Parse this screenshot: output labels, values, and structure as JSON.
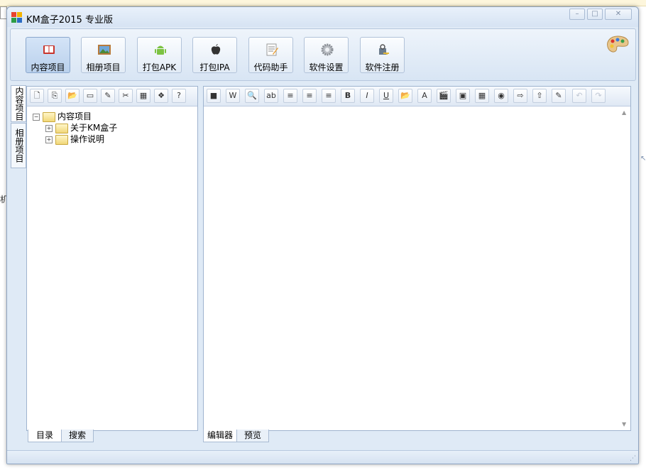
{
  "window": {
    "title": "KM盒子2015 专业版",
    "controls": [
      "minimize",
      "maximize",
      "close"
    ]
  },
  "ribbon": {
    "buttons": [
      {
        "label": "内容项目",
        "icon": "book-icon",
        "active": true
      },
      {
        "label": "相册项目",
        "icon": "picture-icon",
        "active": false
      },
      {
        "label": "打包APK",
        "icon": "android-icon",
        "active": false
      },
      {
        "label": "打包IPA",
        "icon": "apple-icon",
        "active": false
      },
      {
        "label": "代码助手",
        "icon": "notepad-icon",
        "active": false
      },
      {
        "label": "软件设置",
        "icon": "gear-icon",
        "active": false
      },
      {
        "label": "软件注册",
        "icon": "key-icon",
        "active": false
      }
    ],
    "skin_icon": "palette-icon"
  },
  "side_tabs": [
    {
      "label": "内容项目",
      "selected": true
    },
    {
      "label": "相册项目",
      "selected": false
    }
  ],
  "left_toolbar": {
    "icons": [
      "new-file-icon",
      "copy-file-icon",
      "open-folder-icon",
      "export-icon",
      "edit-icon",
      "tools-icon",
      "qrcode-icon",
      "link-icon",
      "help-icon"
    ]
  },
  "tree": {
    "root": {
      "label": "内容项目",
      "expanded": true
    },
    "children": [
      {
        "label": "关于KM盒子",
        "expanded": false
      },
      {
        "label": "操作说明",
        "expanded": false
      }
    ]
  },
  "left_bottom_tabs": [
    {
      "label": "目录",
      "selected": true
    },
    {
      "label": "搜索",
      "selected": false
    }
  ],
  "editor_toolbar": {
    "icons": [
      {
        "name": "save-icon",
        "glyph": "■"
      },
      {
        "name": "word-icon",
        "glyph": "W"
      },
      {
        "name": "find-icon",
        "glyph": "🔍"
      },
      {
        "name": "spellcheck-icon",
        "glyph": "ab"
      },
      {
        "name": "align-left-icon",
        "glyph": "≡"
      },
      {
        "name": "align-center-icon",
        "glyph": "≡"
      },
      {
        "name": "align-right-icon",
        "glyph": "≡"
      },
      {
        "name": "bold-icon",
        "glyph": "B"
      },
      {
        "name": "italic-icon",
        "glyph": "I"
      },
      {
        "name": "underline-icon",
        "glyph": "U"
      },
      {
        "name": "folder-image-icon",
        "glyph": "📂"
      },
      {
        "name": "font-color-icon",
        "glyph": "A"
      },
      {
        "name": "video-icon",
        "glyph": "🎬"
      },
      {
        "name": "image-icon",
        "glyph": "▣"
      },
      {
        "name": "table-icon",
        "glyph": "▦"
      },
      {
        "name": "web-icon",
        "glyph": "◉"
      },
      {
        "name": "import-icon",
        "glyph": "⇨"
      },
      {
        "name": "export-doc-icon",
        "glyph": "⇧"
      },
      {
        "name": "clear-format-icon",
        "glyph": "✎"
      },
      {
        "name": "undo-icon",
        "glyph": "↶"
      },
      {
        "name": "redo-icon",
        "glyph": "↷"
      }
    ]
  },
  "right_bottom_tabs": [
    {
      "label": "编辑器",
      "selected": true
    },
    {
      "label": "预览",
      "selected": false
    }
  ],
  "colors": {
    "window_bg": "#dfeaf6",
    "border": "#8ea4c1"
  }
}
